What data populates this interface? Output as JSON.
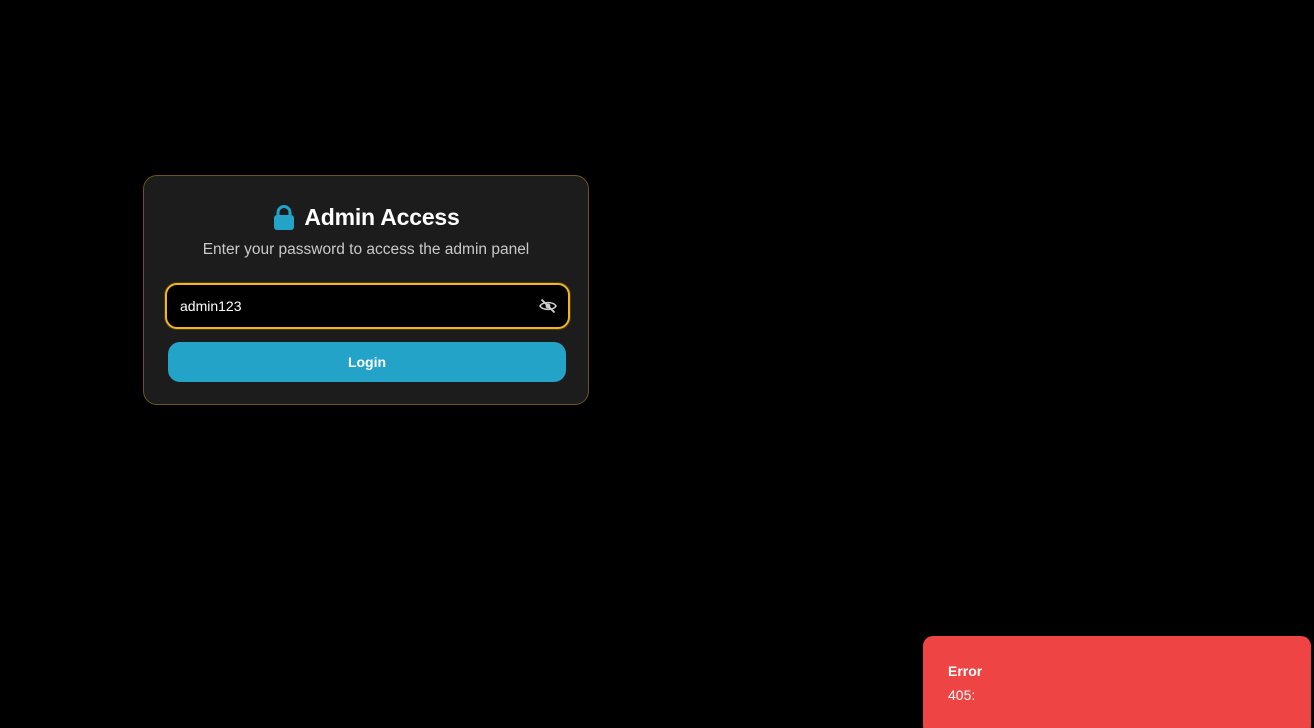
{
  "login": {
    "lock_icon": "lock-icon",
    "title": "Admin Access",
    "subtitle": "Enter your password to access the admin panel",
    "password_value": "admin123",
    "password_visibility_icon": "eye-off-icon",
    "login_label": "Login"
  },
  "toast": {
    "title": "Error",
    "message": "405:"
  },
  "colors": {
    "background": "#000000",
    "card": "#1c1c1d",
    "card_border": "#6b5420",
    "accent": "#24a3c9",
    "focus_ring": "#f0b429",
    "error": "#ef4444"
  }
}
